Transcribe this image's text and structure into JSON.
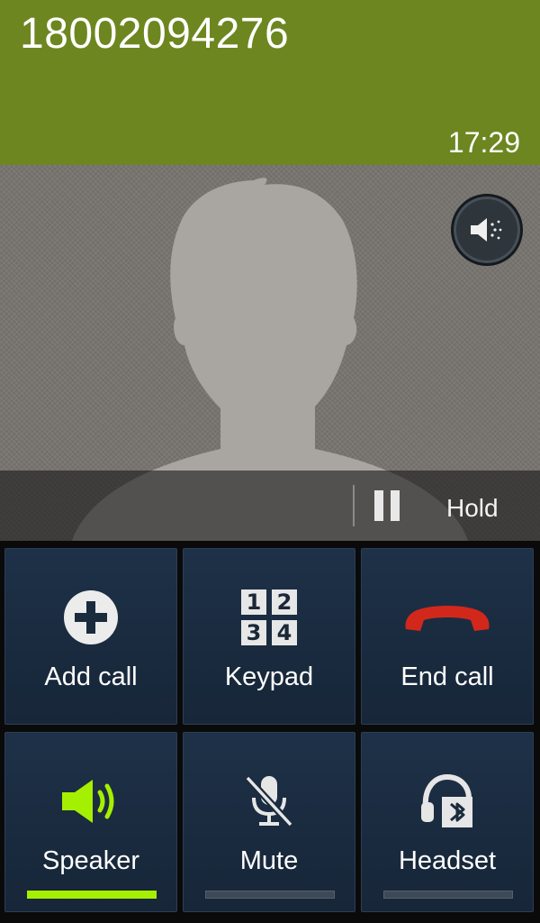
{
  "call": {
    "number": "18002094276",
    "timer": "17:29"
  },
  "hold": {
    "label": "Hold"
  },
  "icons": {
    "speaker_round": "speaker-sound-icon",
    "pause": "pause-icon"
  },
  "buttons": [
    {
      "id": "add-call",
      "label": "Add call",
      "icon": "add-circle-icon"
    },
    {
      "id": "keypad",
      "label": "Keypad",
      "icon": "keypad-grid-icon",
      "keys": [
        "1",
        "2",
        "3",
        "4"
      ]
    },
    {
      "id": "end-call",
      "label": "End call",
      "icon": "end-call-handset-icon"
    },
    {
      "id": "speaker",
      "label": "Speaker",
      "icon": "speaker-icon",
      "toggle": true,
      "on": true
    },
    {
      "id": "mute",
      "label": "Mute",
      "icon": "mic-off-icon",
      "toggle": true,
      "on": false
    },
    {
      "id": "headset",
      "label": "Headset",
      "icon": "bluetooth-headset-icon",
      "toggle": true,
      "on": false
    }
  ],
  "colors": {
    "header_bg": "#6d8620",
    "tile_bg": "#1b2c40",
    "active_indicator": "#a5f000",
    "end_call_red": "#d2281b"
  }
}
